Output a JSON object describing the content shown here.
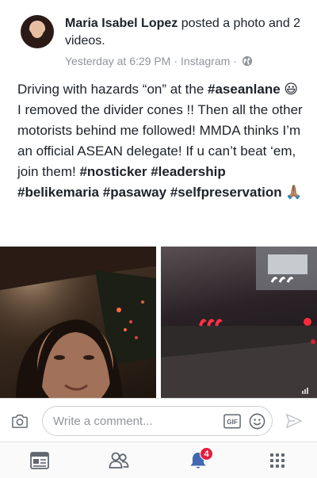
{
  "post": {
    "author": "Maria Isabel Lopez",
    "action": "posted a photo and 2 videos.",
    "timestamp": "Yesterday at 6:29 PM",
    "separator": "·",
    "source": "Instagram",
    "privacy_icon": "globe-icon",
    "body_segments": [
      {
        "text": "Driving with hazards “on” at the ",
        "hashtag": false
      },
      {
        "text": "#aseanlane",
        "hashtag": true
      },
      {
        "text": " 😃 I removed the divider cones !! Then all the other motorists behind me followed! MMDA thinks I’m an official ASEAN delegate! If u can’t beat ‘em, join them! ",
        "hashtag": false
      },
      {
        "text": "#nosticker",
        "hashtag": true
      },
      {
        "text": " ",
        "hashtag": false
      },
      {
        "text": "#leadership",
        "hashtag": true
      },
      {
        "text": " ",
        "hashtag": false
      },
      {
        "text": "#belikemaria",
        "hashtag": true
      },
      {
        "text": " ",
        "hashtag": false
      },
      {
        "text": "#pasaway",
        "hashtag": true
      },
      {
        "text": " ",
        "hashtag": false
      },
      {
        "text": "#selfpreservation",
        "hashtag": true
      },
      {
        "text": " 🙏🏽",
        "hashtag": false
      }
    ],
    "media": [
      "selfie-in-car-photo",
      "night-road-video"
    ]
  },
  "comment_bar": {
    "placeholder": "Write a comment...",
    "icons": [
      "camera-icon",
      "gif-icon",
      "smiley-icon",
      "send-icon"
    ]
  },
  "tab_bar": {
    "tabs": [
      {
        "name": "news-feed",
        "icon": "news-feed-icon"
      },
      {
        "name": "friends",
        "icon": "friends-icon"
      },
      {
        "name": "notifications",
        "icon": "bell-icon",
        "badge": "4"
      },
      {
        "name": "menu",
        "icon": "menu-grid-icon"
      }
    ]
  },
  "colors": {
    "text": "#1d2129",
    "meta": "#90949c",
    "badge": "#e41e3f",
    "active_tab": "#4267b2",
    "inactive_tab": "#606770"
  }
}
